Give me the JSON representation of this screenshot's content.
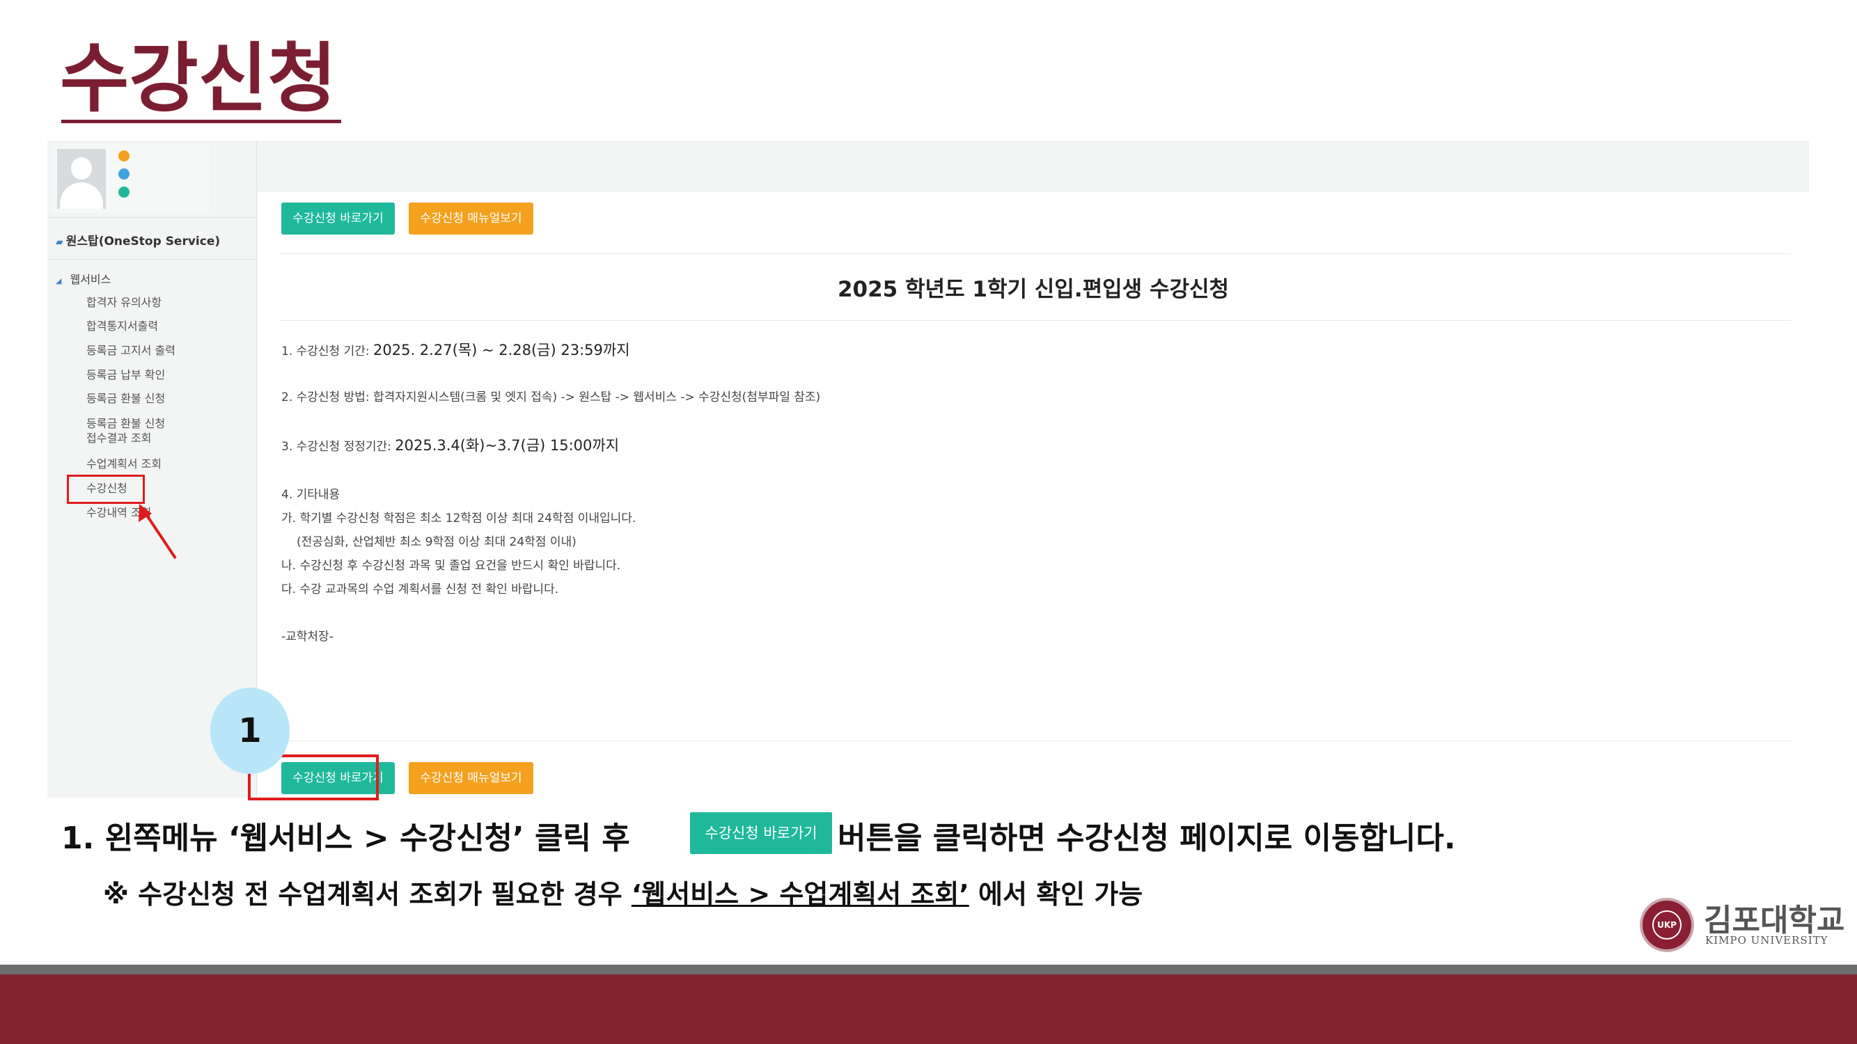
{
  "slide": {
    "title": "수강신청"
  },
  "sidebar": {
    "section_label": "원스탑(OneStop Service)",
    "menu_root": "웹서비스",
    "items": [
      {
        "label": "합격자 유의사항"
      },
      {
        "label": "합격통지서출력"
      },
      {
        "label": "등록금 고지서 출력"
      },
      {
        "label": "등록금 납부 확인"
      },
      {
        "label": "등록금 환불 신청"
      },
      {
        "label": "등록금 환불 신청"
      },
      {
        "label": "접수결과 조회"
      },
      {
        "label": "수업계획서 조회"
      },
      {
        "label": "수강신청"
      },
      {
        "label": "수강내역 조회"
      }
    ],
    "status_colors": [
      "#f4a11f",
      "#3ea4e0",
      "#1fb89b"
    ]
  },
  "main": {
    "btn_go_label": "수강신청 바로가기",
    "btn_manual_label": "수강신청 매뉴얼보기",
    "notice_title": "2025 학년도 1학기 신입.편입생 수강신청",
    "lines": {
      "l1_label": "1. 수강신청 기간:",
      "l1_value": "2025. 2.27(목) ~ 2.28(금) 23:59까지",
      "l2": "2. 수강신청 방법: 합격자지원시스템(크롬 및 엣지 접속) -> 원스탑 -> 웹서비스 -> 수강신청(첨부파일 참조)",
      "l3_label": "3. 수강신청 정정기간:",
      "l3_value": "2025.3.4(화)~3.7(금) 15:00까지",
      "l4": "4. 기타내용",
      "l5": "가. 학기별 수강신청 학점은 최소 12학점 이상 최대 24학점 이내입니다.",
      "l6": "(전공심화, 산업체반 최소 9학점 이상 최대 24학점 이내)",
      "l7": "나. 수강신청 후 수강신청 과목 및 졸업 요건을 반드시 확인 바랍니다.",
      "l8": "다. 수강 교과목의 수업 계획서를 신청 전 확인 바랍니다.",
      "l9": "-교학처장-"
    }
  },
  "callout": {
    "step_number": "1"
  },
  "instructions": {
    "line1_prefix": "1.   왼쪽메뉴 ‘웹서비스 > 수강신청’ 클릭 후",
    "line1_button": "수강신청 바로가기",
    "line1_suffix": "버튼을 클릭하면 수강신청 페이지로 이동합니다.",
    "note_prefix": "※ 수강신청 전 수업계획서 조회가 필요한 경우",
    "note_link": "‘웹서비스 > 수업계획서 조회’",
    "note_suffix": " 에서 확인 가능"
  },
  "logo": {
    "name_ko": "김포대학교",
    "name_en": "KIMPO UNIVERSITY",
    "seal_text": "UKP"
  },
  "colors": {
    "brand_maroon": "#832233",
    "title_maroon": "#7b1e32",
    "button_green": "#1fb89b",
    "button_orange": "#f4a11f",
    "highlight_red": "#e01b1b",
    "callout_blue": "#b8e6f8"
  }
}
